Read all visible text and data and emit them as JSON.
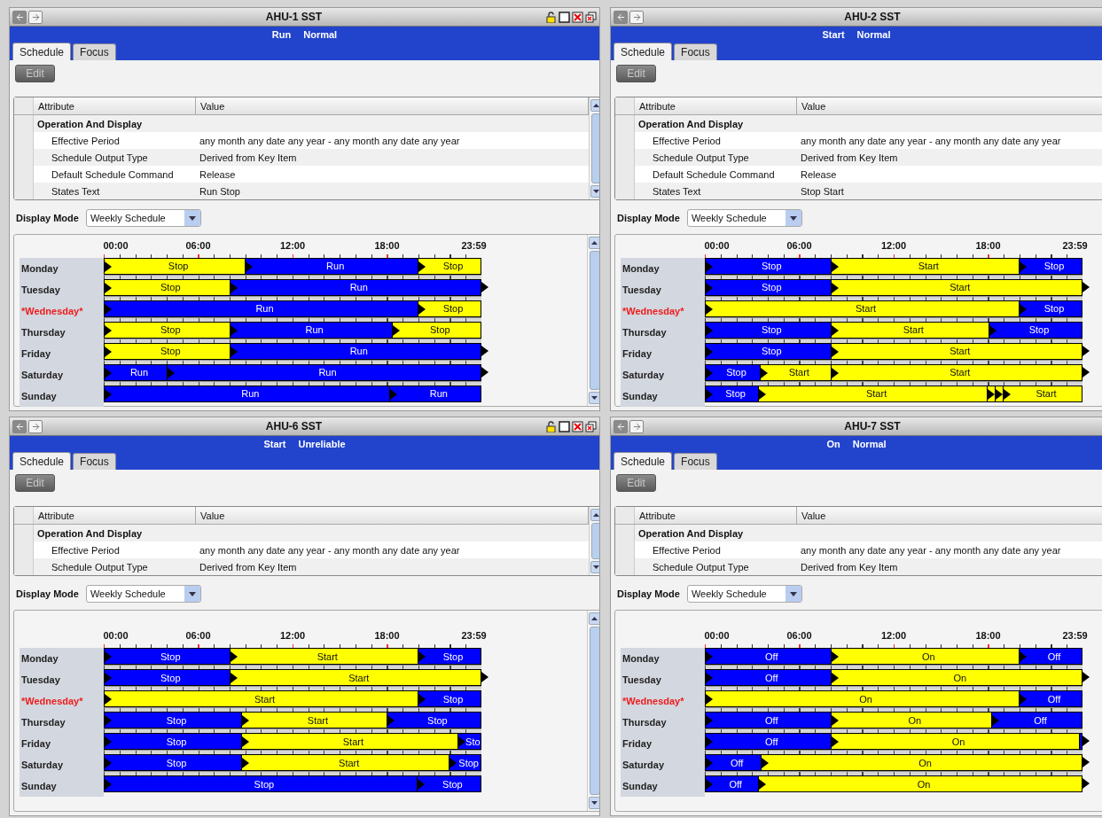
{
  "panels": [
    {
      "title": "AHU-1 SST",
      "right_edge_visible": true,
      "status": [
        "Run",
        "Normal"
      ],
      "tabs": [
        {
          "label": "Schedule",
          "selected": true
        },
        {
          "label": "Focus",
          "selected": false
        }
      ],
      "edit_button": {
        "label": "Edit",
        "disabled": true
      },
      "table": {
        "columns": [
          "Attribute",
          "Value"
        ],
        "group": "Operation And Display",
        "rows": [
          {
            "attribute": "Effective Period",
            "value": "any month any date any year  -  any month any date any year"
          },
          {
            "attribute": "Schedule Output Type",
            "value": "Derived from Key Item"
          },
          {
            "attribute": "Default Schedule Command",
            "value": "Release"
          },
          {
            "attribute": "States Text",
            "value": "Run Stop"
          }
        ]
      },
      "display_mode": {
        "label": "Display Mode",
        "value": "Weekly Schedule"
      },
      "schedule": {
        "axis_labels": [
          "00:00",
          "06:00",
          "12:00",
          "18:00",
          "23:59"
        ],
        "days": [
          {
            "name": "Monday",
            "current": false,
            "end_marker": false,
            "segments": [
              {
                "label": "Stop",
                "color": "#ffff00"
              },
              {
                "label": "Run",
                "color": "#0000ff"
              },
              {
                "label": "Stop",
                "color": "#ffff00"
              }
            ]
          },
          {
            "name": "Tuesday",
            "current": false,
            "end_marker": true,
            "segments": [
              {
                "label": "Stop",
                "color": "#ffff00"
              },
              {
                "label": "Run",
                "color": "#0000ff"
              }
            ]
          },
          {
            "name": "*Wednesday*",
            "current": true,
            "end_marker": false,
            "segments": [
              {
                "label": "Run",
                "color": "#0000ff"
              },
              {
                "label": "Stop",
                "color": "#ffff00"
              }
            ]
          },
          {
            "name": "Thursday",
            "current": false,
            "end_marker": false,
            "segments": [
              {
                "label": "Stop",
                "color": "#ffff00"
              },
              {
                "label": "Run",
                "color": "#0000ff"
              },
              {
                "label": "Stop",
                "color": "#ffff00"
              }
            ]
          },
          {
            "name": "Friday",
            "current": false,
            "end_marker": true,
            "segments": [
              {
                "label": "Stop",
                "color": "#ffff00"
              },
              {
                "label": "Run",
                "color": "#0000ff"
              }
            ]
          },
          {
            "name": "Saturday",
            "current": false,
            "end_marker": true,
            "segments": [
              {
                "label": "Run",
                "color": "#0000ff"
              },
              {
                "label": "Run",
                "color": "#0000ff"
              }
            ]
          },
          {
            "name": "Sunday",
            "current": false,
            "end_marker": false,
            "segments": [
              {
                "label": "Run",
                "color": "#0000ff"
              },
              {
                "label": "Run",
                "color": "#0000ff"
              }
            ]
          }
        ]
      }
    },
    {
      "title": "AHU-2 SST",
      "right_edge_visible": false,
      "status": [
        "Start",
        "Normal"
      ],
      "tabs": [
        {
          "label": "Schedule",
          "selected": true
        },
        {
          "label": "Focus",
          "selected": false
        }
      ],
      "edit_button": {
        "label": "Edit",
        "disabled": true
      },
      "table": {
        "columns": [
          "Attribute",
          "Value"
        ],
        "group": "Operation And Display",
        "rows": [
          {
            "attribute": "Effective Period",
            "value": "any month any date any year  -  any month any date any year"
          },
          {
            "attribute": "Schedule Output Type",
            "value": "Derived from Key Item"
          },
          {
            "attribute": "Default Schedule Command",
            "value": "Release"
          },
          {
            "attribute": "States Text",
            "value": "Stop Start"
          }
        ]
      },
      "display_mode": {
        "label": "Display Mode",
        "value": "Weekly Schedule"
      },
      "schedule": {
        "axis_labels": [
          "00:00",
          "06:00",
          "12:00",
          "18:00",
          "23:59"
        ],
        "days": [
          {
            "name": "Monday",
            "current": false,
            "end_marker": false,
            "segments": [
              {
                "label": "Stop",
                "color": "#0000ff"
              },
              {
                "label": "Start",
                "color": "#ffff00"
              },
              {
                "label": "Stop",
                "color": "#0000ff"
              }
            ]
          },
          {
            "name": "Tuesday",
            "current": false,
            "end_marker": true,
            "segments": [
              {
                "label": "Stop",
                "color": "#0000ff"
              },
              {
                "label": "Start",
                "color": "#ffff00"
              }
            ]
          },
          {
            "name": "*Wednesday*",
            "current": true,
            "end_marker": false,
            "segments": [
              {
                "label": "Start",
                "color": "#ffff00"
              },
              {
                "label": "Stop",
                "color": "#0000ff"
              }
            ]
          },
          {
            "name": "Thursday",
            "current": false,
            "end_marker": false,
            "segments": [
              {
                "label": "Stop",
                "color": "#0000ff"
              },
              {
                "label": "Start",
                "color": "#ffff00"
              },
              {
                "label": "Stop",
                "color": "#0000ff"
              }
            ]
          },
          {
            "name": "Friday",
            "current": false,
            "end_marker": true,
            "segments": [
              {
                "label": "Stop",
                "color": "#0000ff"
              },
              {
                "label": "Start",
                "color": "#ffff00"
              }
            ]
          },
          {
            "name": "Saturday",
            "current": false,
            "end_marker": true,
            "segments": [
              {
                "label": "Stop",
                "color": "#0000ff"
              },
              {
                "label": "Start",
                "color": "#ffff00"
              },
              {
                "label": "Start",
                "color": "#ffff00"
              }
            ]
          },
          {
            "name": "Sunday",
            "current": false,
            "end_marker": false,
            "segments": [
              {
                "label": "Stop",
                "color": "#0000ff"
              },
              {
                "label": "Start",
                "color": "#ffff00"
              },
              {
                "color": "#ffff00"
              },
              {
                "color": "#ffff00"
              },
              {
                "label": "Start",
                "color": "#ffff00"
              }
            ]
          }
        ]
      }
    },
    {
      "title": "AHU-6 SST",
      "right_edge_visible": true,
      "status": [
        "Start",
        "Unreliable"
      ],
      "tabs": [
        {
          "label": "Schedule",
          "selected": true
        },
        {
          "label": "Focus",
          "selected": false
        }
      ],
      "edit_button": {
        "label": "Edit",
        "disabled": true
      },
      "table": {
        "columns": [
          "Attribute",
          "Value"
        ],
        "group": "Operation And Display",
        "rows": [
          {
            "attribute": "Effective Period",
            "value": "any month any date any year  -  any month any date any year"
          },
          {
            "attribute": "Schedule Output Type",
            "value": "Derived from Key Item"
          }
        ]
      },
      "display_mode": {
        "label": "Display Mode",
        "value": "Weekly Schedule"
      },
      "schedule": {
        "axis_labels": [
          "00:00",
          "06:00",
          "12:00",
          "18:00",
          "23:59"
        ],
        "days": [
          {
            "name": "Monday",
            "current": false,
            "end_marker": false,
            "segments": [
              {
                "label": "Stop",
                "color": "#0000ff"
              },
              {
                "label": "Start",
                "color": "#ffff00"
              },
              {
                "label": "Stop",
                "color": "#0000ff"
              }
            ]
          },
          {
            "name": "Tuesday",
            "current": false,
            "end_marker": true,
            "segments": [
              {
                "label": "Stop",
                "color": "#0000ff"
              },
              {
                "label": "Start",
                "color": "#ffff00"
              }
            ]
          },
          {
            "name": "*Wednesday*",
            "current": true,
            "end_marker": false,
            "segments": [
              {
                "label": "Start",
                "color": "#ffff00"
              },
              {
                "label": "Stop",
                "color": "#0000ff"
              }
            ]
          },
          {
            "name": "Thursday",
            "current": false,
            "end_marker": false,
            "segments": [
              {
                "label": "Stop",
                "color": "#0000ff"
              },
              {
                "label": "Start",
                "color": "#ffff00"
              },
              {
                "label": "Stop",
                "color": "#0000ff"
              }
            ]
          },
          {
            "name": "Friday",
            "current": false,
            "end_marker": false,
            "segments": [
              {
                "label": "Stop",
                "color": "#0000ff"
              },
              {
                "label": "Start",
                "color": "#ffff00"
              },
              {
                "label": "Sto",
                "color": "#0000ff"
              }
            ]
          },
          {
            "name": "Saturday",
            "current": false,
            "end_marker": false,
            "segments": [
              {
                "label": "Stop",
                "color": "#0000ff"
              },
              {
                "label": "Start",
                "color": "#ffff00"
              },
              {
                "label": "Stop",
                "color": "#0000ff"
              }
            ]
          },
          {
            "name": "Sunday",
            "current": false,
            "end_marker": false,
            "segments": [
              {
                "label": "Stop",
                "color": "#0000ff"
              },
              {
                "label": "Stop",
                "color": "#0000ff"
              }
            ]
          }
        ]
      }
    },
    {
      "title": "AHU-7 SST",
      "right_edge_visible": false,
      "status": [
        "On",
        "Normal"
      ],
      "tabs": [
        {
          "label": "Schedule",
          "selected": true
        },
        {
          "label": "Focus",
          "selected": false
        }
      ],
      "edit_button": {
        "label": "Edit",
        "disabled": true
      },
      "table": {
        "columns": [
          "Attribute",
          "Value"
        ],
        "group": "Operation And Display",
        "rows": [
          {
            "attribute": "Effective Period",
            "value": "any month any date any year  -  any month any date any year"
          },
          {
            "attribute": "Schedule Output Type",
            "value": "Derived from Key Item"
          }
        ]
      },
      "display_mode": {
        "label": "Display Mode",
        "value": "Weekly Schedule"
      },
      "schedule": {
        "axis_labels": [
          "00:00",
          "06:00",
          "12:00",
          "18:00",
          "23:59"
        ],
        "days": [
          {
            "name": "Monday",
            "current": false,
            "end_marker": false,
            "segments": [
              {
                "label": "Off",
                "color": "#0000ff"
              },
              {
                "label": "On",
                "color": "#ffff00"
              },
              {
                "label": "Off",
                "color": "#0000ff"
              }
            ]
          },
          {
            "name": "Tuesday",
            "current": false,
            "end_marker": true,
            "segments": [
              {
                "label": "Off",
                "color": "#0000ff"
              },
              {
                "label": "On",
                "color": "#ffff00"
              }
            ]
          },
          {
            "name": "*Wednesday*",
            "current": true,
            "end_marker": false,
            "segments": [
              {
                "label": "On",
                "color": "#ffff00"
              },
              {
                "label": "Off",
                "color": "#0000ff"
              }
            ]
          },
          {
            "name": "Thursday",
            "current": false,
            "end_marker": false,
            "segments": [
              {
                "label": "Off",
                "color": "#0000ff"
              },
              {
                "label": "On",
                "color": "#ffff00"
              },
              {
                "label": "Off",
                "color": "#0000ff"
              }
            ]
          },
          {
            "name": "Friday",
            "current": false,
            "end_marker": true,
            "segments": [
              {
                "label": "Off",
                "color": "#0000ff"
              },
              {
                "label": "On",
                "color": "#ffff00"
              },
              {
                "color": "#0000ff"
              }
            ]
          },
          {
            "name": "Saturday",
            "current": false,
            "end_marker": true,
            "segments": [
              {
                "label": "Off",
                "color": "#0000ff"
              },
              {
                "label": "On",
                "color": "#ffff00"
              }
            ]
          },
          {
            "name": "Sunday",
            "current": false,
            "end_marker": true,
            "segments": [
              {
                "label": "Off",
                "color": "#0000ff"
              },
              {
                "label": "On",
                "color": "#ffff00"
              }
            ]
          }
        ]
      }
    }
  ]
}
